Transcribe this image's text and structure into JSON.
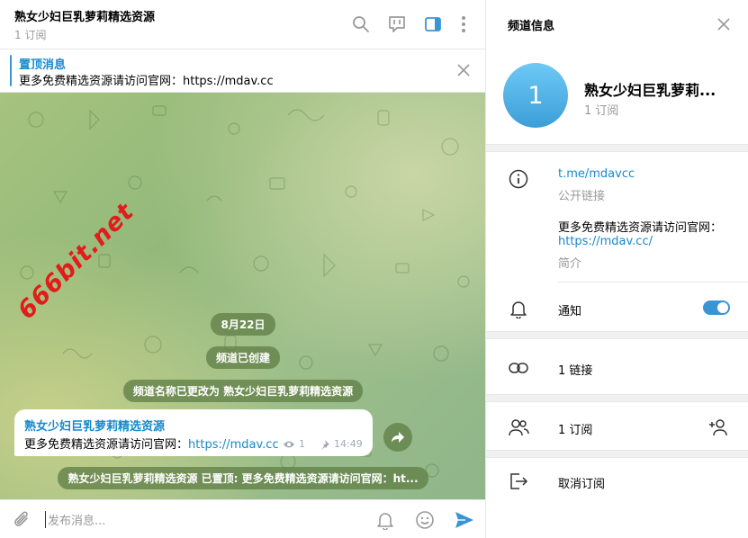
{
  "header": {
    "title": "熟女少妇巨乳萝莉精选资源",
    "subscribers": "1 订阅",
    "icons": [
      "search-icon",
      "reply-bubble-icon",
      "sidebar-toggle-icon",
      "more-vertical-icon"
    ]
  },
  "pinned": {
    "title": "置顶消息",
    "text": "更多免费精选资源请访问官网：https://mdav.cc"
  },
  "watermark": "666bit.net",
  "service": {
    "date": "8月22日",
    "created": "频道已创建",
    "renamed": "频道名称已更改为 熟女少妇巨乳萝莉精选资源",
    "pinned_notice": "熟女少妇巨乳萝莉精选资源 已置顶: 更多免费精选资源请访问官网：ht..."
  },
  "message": {
    "author": "熟女少妇巨乳萝莉精选资源",
    "text_prefix": "更多免费精选资源请访问官网：",
    "link": "https://mdav.cc",
    "views": "1",
    "time": "14:49"
  },
  "composer": {
    "placeholder": "发布消息..."
  },
  "panel": {
    "title": "频道信息",
    "avatar_letter": "1",
    "name": "熟女少妇巨乳萝莉...",
    "subscribers": "1 订阅",
    "link": "t.me/mdavcc",
    "link_label": "公开链接",
    "description": "更多免费精选资源请访问官网：",
    "description_link": "https://mdav.cc/",
    "description_label": "简介",
    "notifications": "通知",
    "notifications_on": true,
    "links_count": "1 链接",
    "subscribers_row": "1 订阅",
    "unsubscribe": "取消订阅"
  },
  "colors": {
    "accent": "#168acd",
    "toggle": "#3a95d5",
    "service_bg": "#628048"
  }
}
